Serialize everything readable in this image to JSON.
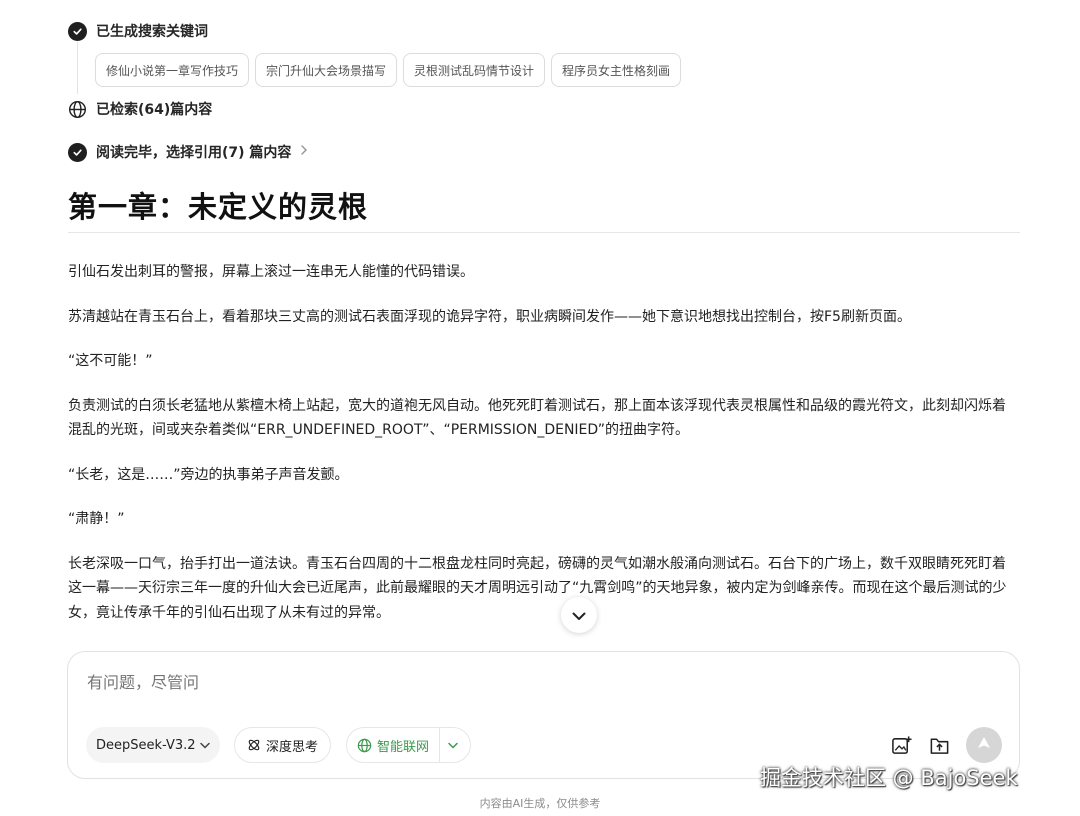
{
  "steps": {
    "keywords_label": "已生成搜索关键词",
    "searched_label": "已检索(64)篇内容",
    "reading_label": "阅读完毕，选择引用(7) 篇内容"
  },
  "keywords": [
    "修仙小说第一章写作技巧",
    "宗门升仙大会场景描写",
    "灵根测试乱码情节设计",
    "程序员女主性格刻画"
  ],
  "chapter": {
    "title": "第一章：未定义的灵根",
    "paragraphs": [
      "引仙石发出刺耳的警报，屏幕上滚过一连串无人能懂的代码错误。",
      "苏清越站在青玉石台上，看着那块三丈高的测试石表面浮现的诡异字符，职业病瞬间发作——她下意识地想找出控制台，按F5刷新页面。",
      "“这不可能！”",
      "负责测试的白须长老猛地从紫檀木椅上站起，宽大的道袍无风自动。他死死盯着测试石，那上面本该浮现代表灵根属性和品级的霞光符文，此刻却闪烁着混乱的光斑，间或夹杂着类似“ERR_UNDEFINED_ROOT”、“PERMISSION_DENIED”的扭曲字符。",
      "“长老，这是……”旁边的执事弟子声音发颤。",
      "“肃静！”",
      "长老深吸一口气，抬手打出一道法诀。青玉石台四周的十二根盘龙柱同时亮起，磅礴的灵气如潮水般涌向测试石。石台下的广场上，数千双眼睛死死盯着这一幕——天衍宗三年一度的升仙大会已近尾声，此前最耀眼的天才周明远引动了“九霄剑鸣”的天地异象，被内定为剑峰亲传。而现在这个最后测试的少女，竟让传承千年的引仙石出现了从未有过的异常。"
    ]
  },
  "composer": {
    "placeholder": "有问题，尽管问",
    "model_label": "DeepSeek-V3.2",
    "deep_think_label": "深度思考",
    "web_search_label": "智能联网"
  },
  "footer": {
    "note": "内容由AI生成，仅供参考"
  },
  "watermark": "掘金技术社区 @ BajoSeek",
  "colors": {
    "accent_green": "#3a9a4a",
    "send_disabled": "#d6d6d6"
  }
}
